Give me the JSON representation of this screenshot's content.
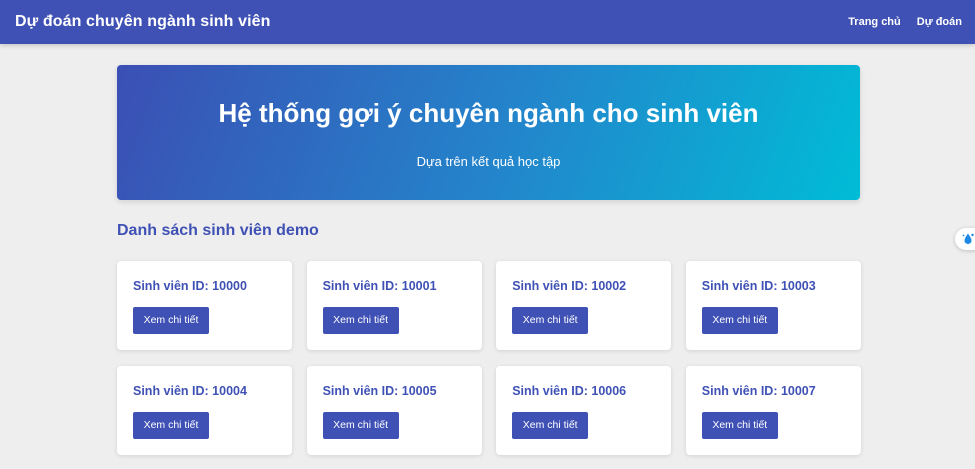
{
  "navbar": {
    "brand": "Dự đoán chuyên ngành sinh viên",
    "links": [
      {
        "label": "Trang chủ"
      },
      {
        "label": "Dự đoán"
      }
    ]
  },
  "hero": {
    "title": "Hệ thống gợi ý chuyên ngành cho sinh viên",
    "subtitle": "Dựa trên kết quả học tập"
  },
  "section": {
    "title": "Danh sách sinh viên demo"
  },
  "students": [
    {
      "title": "Sinh viên ID: 10000",
      "button": "Xem chi tiết"
    },
    {
      "title": "Sinh viên ID: 10001",
      "button": "Xem chi tiết"
    },
    {
      "title": "Sinh viên ID: 10002",
      "button": "Xem chi tiết"
    },
    {
      "title": "Sinh viên ID: 10003",
      "button": "Xem chi tiết"
    },
    {
      "title": "Sinh viên ID: 10004",
      "button": "Xem chi tiết"
    },
    {
      "title": "Sinh viên ID: 10005",
      "button": "Xem chi tiết"
    },
    {
      "title": "Sinh viên ID: 10006",
      "button": "Xem chi tiết"
    },
    {
      "title": "Sinh viên ID: 10007",
      "button": "Xem chi tiết"
    }
  ],
  "side_widget": {
    "icon": "extension-drop-icon"
  },
  "colors": {
    "primary": "#3f51b5",
    "gradient_start": "#3b4fb4",
    "gradient_end": "#00bcd6",
    "background": "#eeeeee"
  }
}
